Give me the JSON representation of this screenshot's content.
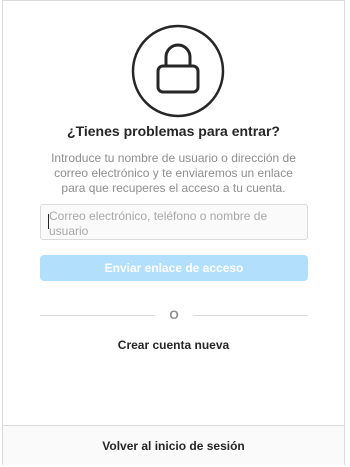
{
  "lock": {
    "icon": "lock-icon"
  },
  "heading": {
    "title": "¿Tienes problemas para entrar?"
  },
  "description": "Introduce tu nombre de usuario o dirección de correo electrónico y te enviaremos un enlace para que recuperes el acceso a tu cuenta.",
  "form": {
    "identifier_placeholder": "Correo electrónico, teléfono o nombre de usuario",
    "identifier_value": "",
    "submit_label": "Enviar enlace de acceso",
    "submit_color": "#b2dffc"
  },
  "divider": {
    "or_label": "O"
  },
  "create_account_label": "Crear cuenta nueva",
  "footer": {
    "back_label": "Volver al inicio de sesión"
  }
}
